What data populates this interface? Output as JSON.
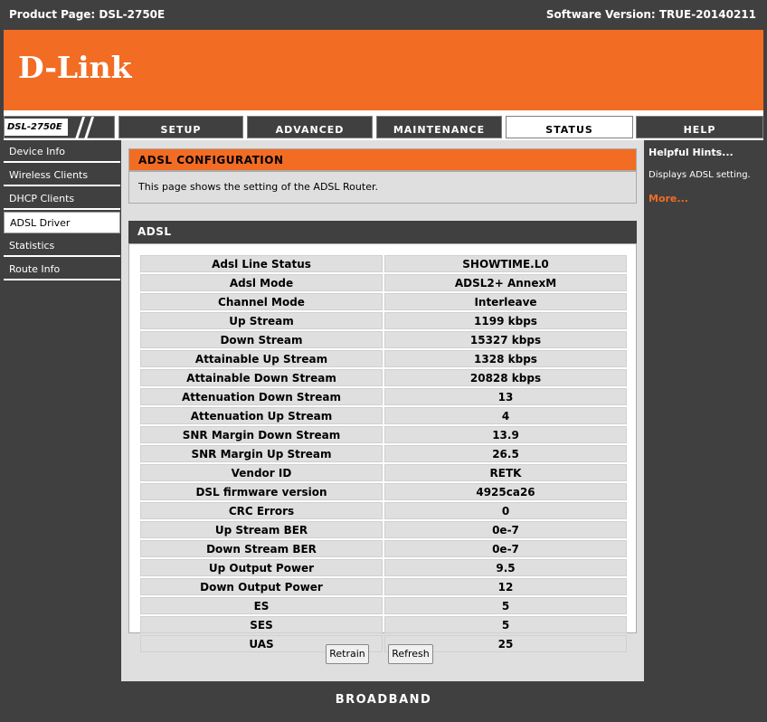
{
  "top_bar": {
    "product": "Product Page: DSL-2750E",
    "version": "Software Version: TRUE-20140211"
  },
  "brand": {
    "logo": "D-Link",
    "accent": "#f26c24",
    "dark": "#404040"
  },
  "model_badge": "DSL-2750E",
  "tabs": [
    {
      "label": "SETUP",
      "active": false
    },
    {
      "label": "ADVANCED",
      "active": false
    },
    {
      "label": "MAINTENANCE",
      "active": false
    },
    {
      "label": "STATUS",
      "active": true
    },
    {
      "label": "HELP",
      "active": false
    }
  ],
  "sidebar": {
    "items": [
      {
        "label": "Device Info",
        "active": false
      },
      {
        "label": "Wireless Clients",
        "active": false
      },
      {
        "label": "DHCP Clients",
        "active": false
      },
      {
        "label": "ADSL Driver",
        "active": true
      },
      {
        "label": "Statistics",
        "active": false
      },
      {
        "label": "Route Info",
        "active": false
      }
    ]
  },
  "config_panel": {
    "title": "ADSL CONFIGURATION",
    "description": "This page shows the setting of the ADSL Router."
  },
  "adsl_panel": {
    "title": "ADSL",
    "rows": [
      {
        "label": "Adsl Line Status",
        "value": "SHOWTIME.L0"
      },
      {
        "label": "Adsl Mode",
        "value": "ADSL2+ AnnexM"
      },
      {
        "label": "Channel Mode",
        "value": "Interleave"
      },
      {
        "label": "Up Stream",
        "value": "1199 kbps"
      },
      {
        "label": "Down Stream",
        "value": "15327 kbps"
      },
      {
        "label": "Attainable Up Stream",
        "value": "1328 kbps"
      },
      {
        "label": "Attainable Down Stream",
        "value": "20828 kbps"
      },
      {
        "label": "Attenuation Down Stream",
        "value": "13"
      },
      {
        "label": "Attenuation Up Stream",
        "value": "4"
      },
      {
        "label": "SNR Margin Down Stream",
        "value": "13.9"
      },
      {
        "label": "SNR Margin Up Stream",
        "value": "26.5"
      },
      {
        "label": "Vendor ID",
        "value": "RETK"
      },
      {
        "label": "DSL firmware version",
        "value": "4925ca26"
      },
      {
        "label": "CRC Errors",
        "value": "0"
      },
      {
        "label": "Up Stream BER",
        "value": "0e-7"
      },
      {
        "label": "Down Stream BER",
        "value": "0e-7"
      },
      {
        "label": "Up Output Power",
        "value": "9.5"
      },
      {
        "label": "Down Output Power",
        "value": "12"
      },
      {
        "label": "ES",
        "value": "5"
      },
      {
        "label": "SES",
        "value": "5"
      },
      {
        "label": "UAS",
        "value": "25"
      }
    ]
  },
  "buttons": {
    "retrain": "Retrain",
    "refresh": "Refresh"
  },
  "hints": {
    "title": "Helpful Hints...",
    "text": "Displays ADSL setting.",
    "more": "More..."
  },
  "footer": "BROADBAND"
}
